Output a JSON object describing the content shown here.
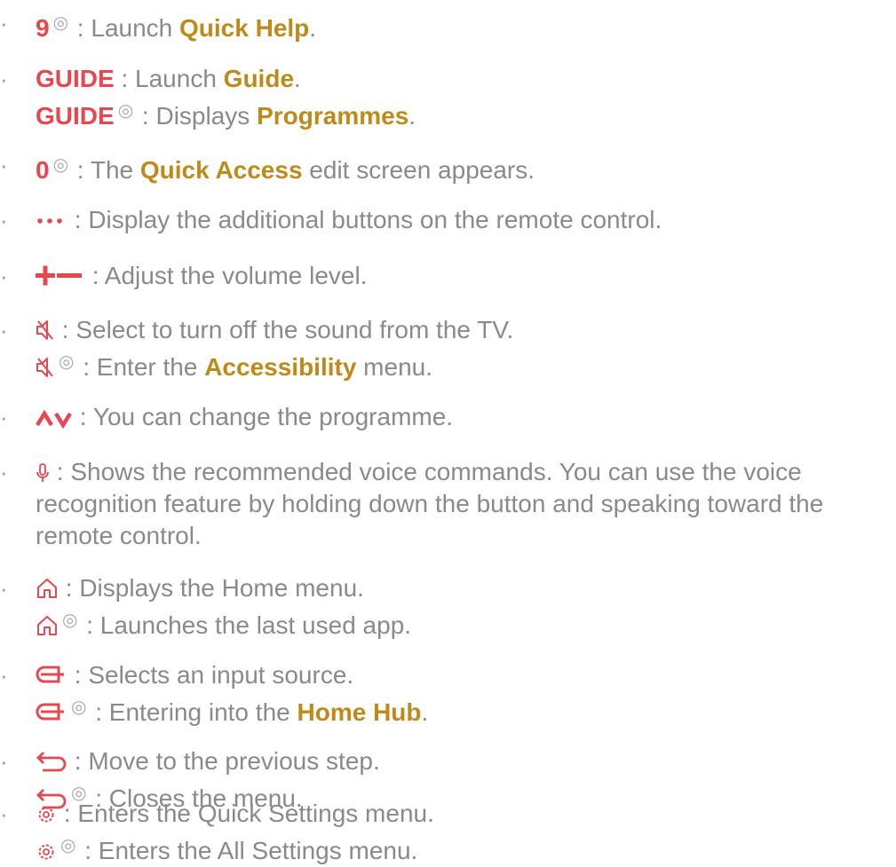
{
  "bullet": "·",
  "hold_symbol": "◎",
  "colors": {
    "text": "#8a8a8a",
    "key": "#e8474f",
    "highlight": "#c08a1a"
  },
  "items": [
    {
      "lines": [
        {
          "key": "9",
          "hold": true,
          "text1": " : Launch ",
          "hl": "Quick Help",
          "text2": "."
        }
      ]
    },
    {
      "lines": [
        {
          "key": "GUIDE",
          "text1": " : Launch ",
          "hl": "Guide",
          "text2": "."
        },
        {
          "key": "GUIDE",
          "hold": true,
          "text1": " : Displays ",
          "hl": "Programmes",
          "text2": "."
        }
      ]
    },
    {
      "lines": [
        {
          "key": "0",
          "hold": true,
          "text1": " : The ",
          "hl": "Quick Access",
          "text2": " edit screen appears."
        }
      ]
    },
    {
      "lines": [
        {
          "icon": "more-dots-icon",
          "text1": " : Display the additional buttons on the remote control."
        }
      ]
    },
    {
      "lines": [
        {
          "icon": "volume-plus-minus-icon",
          "text1": " : Adjust the volume level."
        }
      ]
    },
    {
      "lines": [
        {
          "icon": "mute-icon",
          "text1": " : Select to turn off the sound from the TV."
        },
        {
          "icon": "mute-icon",
          "hold": true,
          "text1": " : Enter the ",
          "hl": "Accessibility",
          "text2": " menu."
        }
      ]
    },
    {
      "lines": [
        {
          "icon": "channel-up-down-icon",
          "text1": " : You can change the programme."
        }
      ]
    },
    {
      "lines": [
        {
          "icon": "microphone-icon",
          "text1": " : Shows the recommended voice commands. You can use the voice recognition feature by holding down the button and speaking toward the remote control."
        }
      ]
    },
    {
      "lines": [
        {
          "icon": "home-icon",
          "text1": " : Displays the Home menu."
        },
        {
          "icon": "home-icon",
          "hold": true,
          "text1": " : Launches the last used app."
        }
      ]
    },
    {
      "lines": [
        {
          "icon": "input-source-icon",
          "text1": " : Selects an input source."
        },
        {
          "icon": "input-source-icon",
          "hold": true,
          "text1": " : Entering into the ",
          "hl": "Home Hub",
          "text2": "."
        }
      ]
    },
    {
      "lines": [
        {
          "icon": "back-arrow-icon",
          "text1": " : Move to the previous step."
        },
        {
          "icon": "back-arrow-icon",
          "hold": true,
          "text1": " : Closes the menu."
        }
      ]
    },
    {
      "lines": [
        {
          "icon": "settings-gear-icon",
          "text1": " : Enters the Quick Settings menu."
        },
        {
          "icon": "settings-gear-icon",
          "hold": true,
          "text1": " : Enters the All Settings menu."
        }
      ]
    }
  ]
}
